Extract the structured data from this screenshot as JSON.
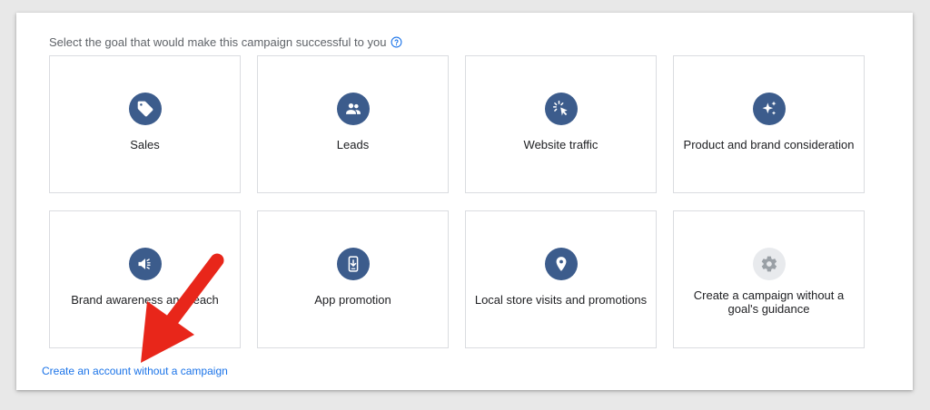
{
  "heading": "Select the goal that would make this campaign successful to you",
  "help_icon": "help-circle-icon",
  "goals": [
    {
      "label": "Sales",
      "icon": "tag-icon"
    },
    {
      "label": "Leads",
      "icon": "people-icon"
    },
    {
      "label": "Website traffic",
      "icon": "cursor-click-icon"
    },
    {
      "label": "Product and brand consideration",
      "icon": "sparkle-icon"
    },
    {
      "label": "Brand awareness and reach",
      "icon": "megaphone-icon"
    },
    {
      "label": "App promotion",
      "icon": "phone-download-icon"
    },
    {
      "label": "Local store visits and promotions",
      "icon": "location-pin-icon"
    },
    {
      "label": "Create a campaign without a goal's guidance",
      "icon": "gear-icon"
    }
  ],
  "footer_link": "Create an account without a campaign",
  "colors": {
    "icon_circle": "#3c5c8c",
    "icon_circle_grey": "#e8eaed",
    "link": "#1a73e8",
    "annotation_arrow": "#e8261a"
  },
  "annotation": "red-arrow-pointing-to-footer-link"
}
